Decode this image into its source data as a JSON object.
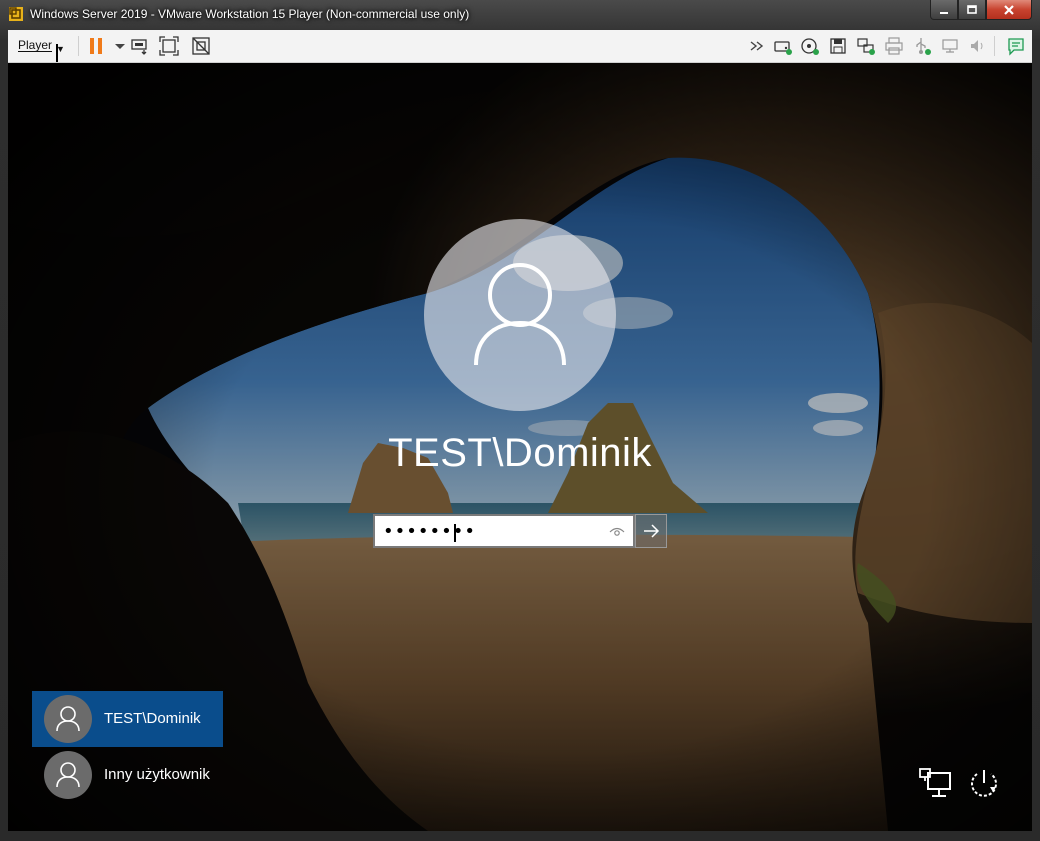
{
  "window": {
    "title": "Windows Server 2019 - VMware Workstation 15 Player (Non-commercial use only)"
  },
  "toolbar": {
    "player_menu_label": "Player",
    "left_icons": [
      "pause-icon",
      "dropdown-arrow-icon",
      "send-ctrl-alt-del-icon",
      "fullscreen-icon",
      "unity-icon"
    ],
    "right_icons": [
      "chevrons-icon",
      "hard-disk-icon",
      "cd-dvd-icon",
      "floppy-icon",
      "network-adapter-icon",
      "printer-icon",
      "usb-icon",
      "display-icon",
      "sound-icon",
      "message-log-icon"
    ]
  },
  "login": {
    "username": "TEST\\Dominik",
    "password_masked": "••••••••",
    "users": [
      {
        "label": "TEST\\Dominik",
        "selected": true
      },
      {
        "label": "Inny użytkownik",
        "selected": false
      }
    ]
  },
  "colors": {
    "selected_tile": "#0a4d8c",
    "pause_accent": "#f07a19"
  }
}
